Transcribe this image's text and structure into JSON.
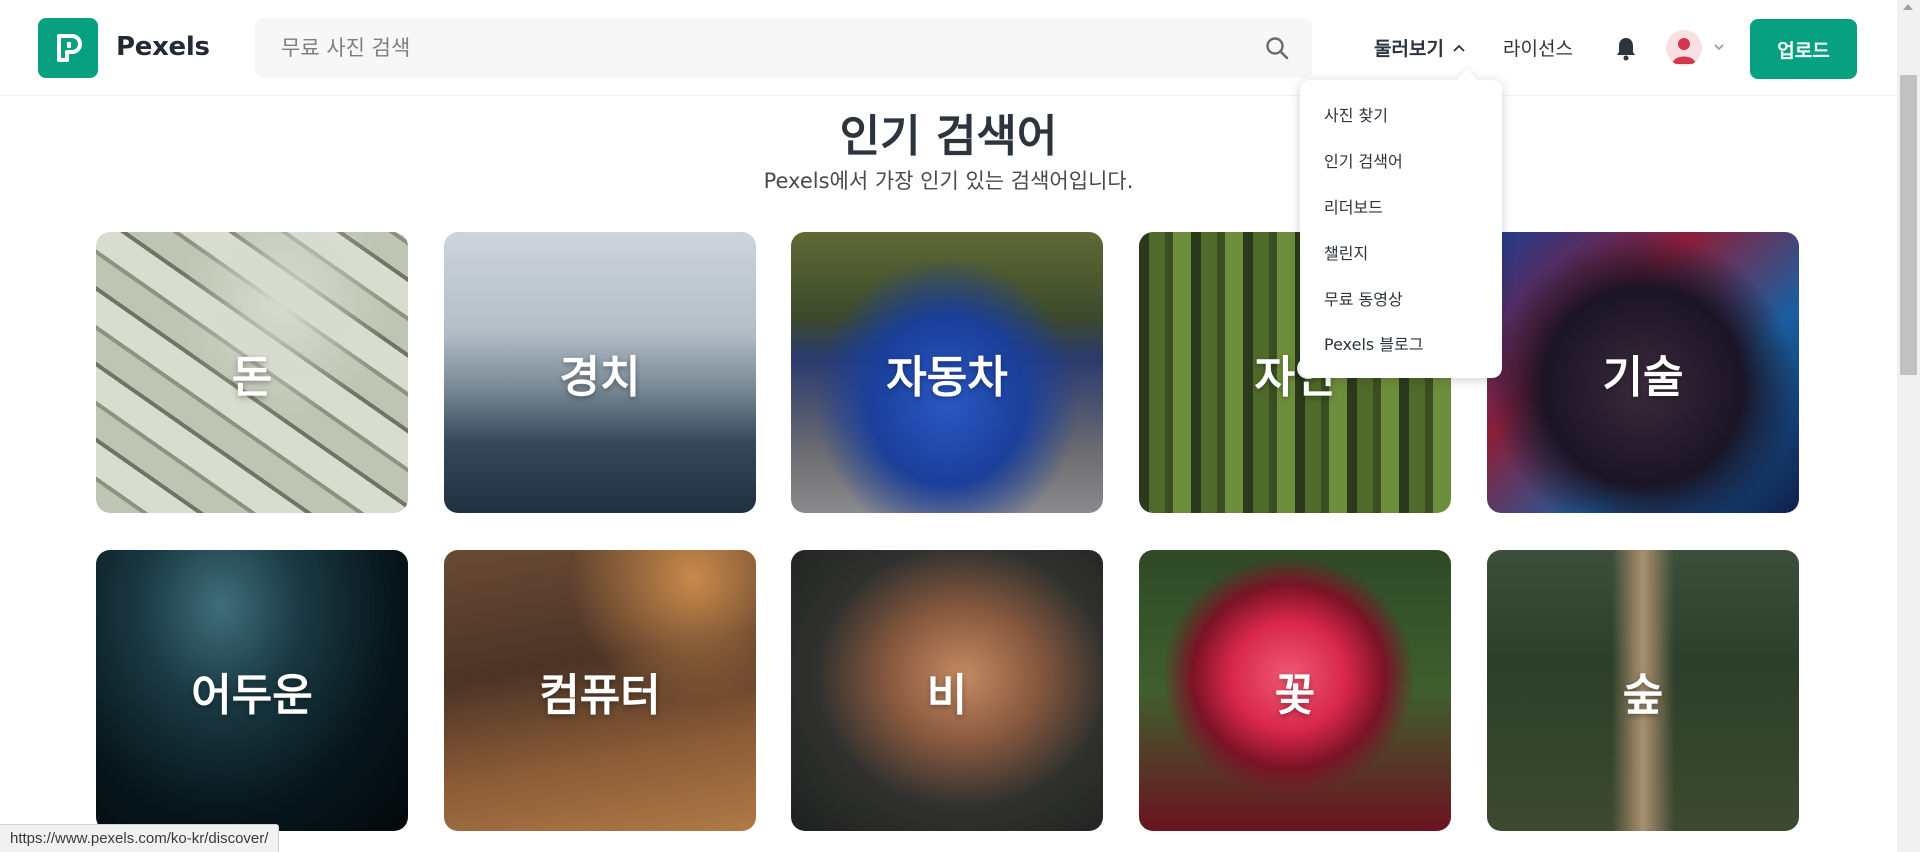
{
  "header": {
    "logo_letter": "P",
    "logo_text": "Pexels",
    "search_placeholder": "무료 사진 검색",
    "nav_explore": "둘러보기",
    "nav_license": "라이선스",
    "upload_label": "업로드"
  },
  "hero": {
    "title": "인기 검색어",
    "subtitle": "Pexels에서 가장 인기 있는 검색어입니다."
  },
  "tiles": [
    {
      "label": "돈"
    },
    {
      "label": "경치"
    },
    {
      "label": "자동차"
    },
    {
      "label": "자연"
    },
    {
      "label": "기술"
    },
    {
      "label": "어두운"
    },
    {
      "label": "컴퓨터"
    },
    {
      "label": "비"
    },
    {
      "label": "꽃"
    },
    {
      "label": "숲"
    }
  ],
  "dropdown": {
    "items": [
      {
        "label": "사진 찾기"
      },
      {
        "label": "인기 검색어"
      },
      {
        "label": "리더보드"
      },
      {
        "label": "챌린지"
      },
      {
        "label": "무료 동영상"
      },
      {
        "label": "Pexels 블로그"
      }
    ]
  },
  "statusbar": {
    "url": "https://www.pexels.com/ko-kr/discover/"
  },
  "colors": {
    "brand": "#07a081",
    "text": "#2c343e"
  },
  "icons": {
    "search": "search-icon",
    "bell": "bell-icon",
    "chevron_up": "chevron-up-icon",
    "chevron_down": "chevron-down-icon",
    "avatar": "user-avatar-icon"
  }
}
